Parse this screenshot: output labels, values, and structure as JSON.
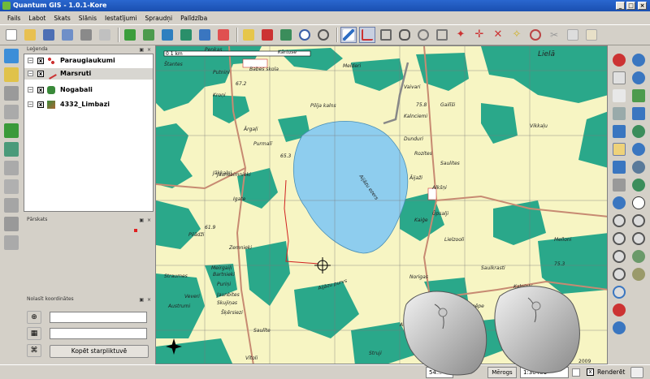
{
  "window": {
    "title": "Quantum GIS - 1.0.1-Kore"
  },
  "menu": [
    "Fails",
    "Labot",
    "Skats",
    "Slānis",
    "Iestatījumi",
    "Spraudņi",
    "Palīdzība"
  ],
  "legend": {
    "title": "Leģenda",
    "layers": [
      {
        "name": "Paraugiaukumi",
        "checked": "x",
        "selected": false
      },
      {
        "name": "Marsruti",
        "checked": "x",
        "selected": true
      },
      {
        "name": "Nogabali",
        "checked": "x",
        "selected": false
      },
      {
        "name": "4332_Limbazi",
        "checked": "x",
        "selected": false
      }
    ]
  },
  "overview": {
    "title": "Pārskats"
  },
  "coordinates_panel": {
    "title": "Nolasīt koordinātes",
    "copy_button": "Kopēt starpliktuvē",
    "field1": "",
    "field2": ""
  },
  "map": {
    "scale_label": "0     1 km",
    "labels": [
      "Penkas",
      "Kārtuse",
      "Štantes",
      "Babes skola",
      "Melderi",
      "Putniņi",
      "Lielā",
      "67.2",
      "Kroņi",
      "Pilija kalns",
      "Vaivari",
      "75.8",
      "Gailīši",
      "Kalnciemi",
      "Ārgaļi",
      "Purmalī",
      "65.3",
      "Dunduri",
      "Rozites",
      "Saulites",
      "Vikkaļu",
      "Jaunsaimnieki",
      "Āijaži",
      "Alkšņi",
      "Jāķkalni",
      "Kaiģe",
      "Ūpsalji",
      "Igate",
      "61.9",
      "Lielzooli",
      "Pilādži",
      "Zemnieki",
      "Melloni",
      "75.3",
      "Meirgaiļi",
      "Bartnieki",
      "Puriņi",
      "Norigas",
      "Saulkrasti",
      "Kalnieki",
      "Straumes",
      "Veveri",
      "Jaunbites",
      "Skujiņas",
      "Šķērsiezi",
      "Austrumi",
      "Spēpe",
      "Saulīte",
      "Akciņi",
      "Vītoli",
      "Struji",
      "Aijāzu ezers",
      "Aijāzu purvs",
      "2009"
    ]
  },
  "status": {
    "coords": "54...",
    "scale_button": "Mērogs",
    "scale_value": "1:30481",
    "render_label": "Renderēt",
    "render_checked": "x"
  },
  "colors": {
    "water": "#8ecdee",
    "forest": "#2aa88a",
    "field": "#f7f5c3",
    "road": "#c78a72",
    "selection": "#6d7ea8"
  }
}
